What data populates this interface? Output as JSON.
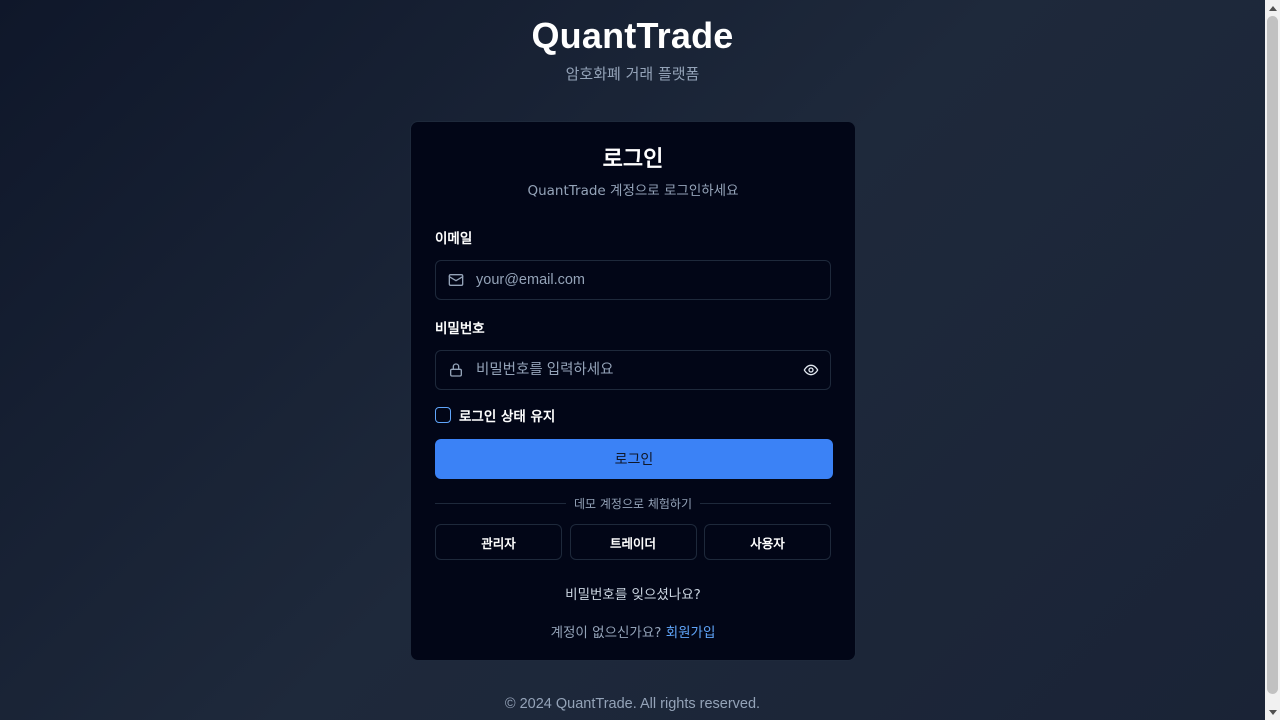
{
  "brand": {
    "title": "QuantTrade",
    "subtitle": "암호화폐 거래 플랫폼"
  },
  "login_card": {
    "title": "로그인",
    "subtitle": "QuantTrade 계정으로 로그인하세요",
    "email": {
      "label": "이메일",
      "value": "",
      "placeholder": "your@email.com",
      "icon": "mail-icon"
    },
    "password": {
      "label": "비밀번호",
      "value": "",
      "placeholder": "비밀번호를 입력하세요",
      "icon": "lock-icon",
      "toggle_icon": "eye-icon"
    },
    "remember_me": {
      "label": "로그인 상태 유지",
      "checked": false
    },
    "submit_label": "로그인",
    "demo_divider": "데모 계정으로 체험하기",
    "demo_accounts": [
      {
        "label": "관리자"
      },
      {
        "label": "트레이더"
      },
      {
        "label": "사용자"
      }
    ],
    "forgot_password": "비밀번호를 잊으셨나요?",
    "signup_prompt": "계정이 없으신가요?",
    "signup_link": "회원가입"
  },
  "footer": {
    "text": "© 2024 QuantTrade. All rights reserved."
  },
  "colors": {
    "accent": "#3b82f6",
    "link": "#60a5fa",
    "card_bg": "#020617",
    "page_bg": "#0f172a",
    "muted_text": "#94a3b8"
  }
}
